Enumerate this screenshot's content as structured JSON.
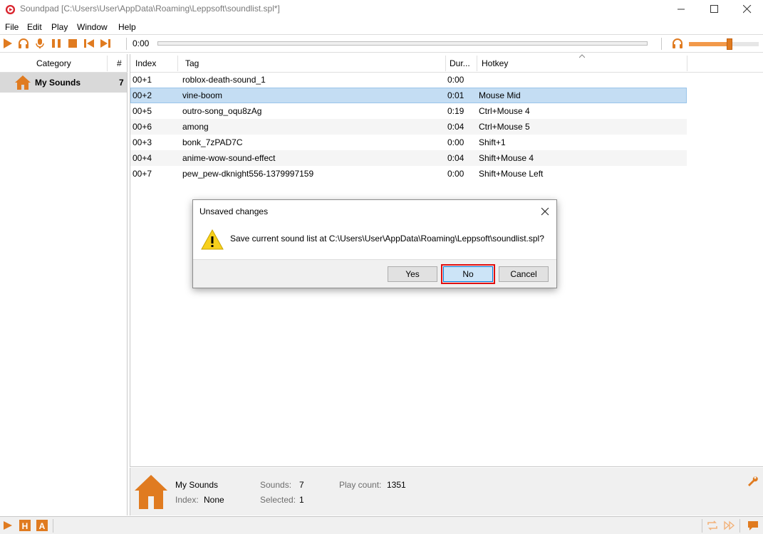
{
  "window": {
    "title": "Soundpad [C:\\Users\\User\\AppData\\Roaming\\Leppsoft\\soundlist.spl*]",
    "accent": "#e07b20"
  },
  "menu": [
    "File",
    "Edit",
    "Play",
    "Window",
    "Help"
  ],
  "toolbar": {
    "time": "0:00",
    "volume_fraction": 0.58,
    "icons": [
      "play-icon",
      "headphones-icon",
      "microphone-icon",
      "pause-icon",
      "stop-icon",
      "previous-icon",
      "next-icon",
      "headphones-icon"
    ]
  },
  "categories": {
    "header_category": "Category",
    "header_count": "#",
    "items": [
      {
        "name": "My Sounds",
        "count": "7"
      }
    ]
  },
  "table": {
    "columns": [
      "Index",
      "Tag",
      "Dur...",
      "Hotkey"
    ],
    "rows": [
      {
        "index": "00+1",
        "tag": "roblox-death-sound_1",
        "duration": "0:00",
        "hotkey": "",
        "selected": false
      },
      {
        "index": "00+2",
        "tag": "vine-boom",
        "duration": "0:01",
        "hotkey": "Mouse Mid",
        "selected": true
      },
      {
        "index": "00+5",
        "tag": "outro-song_oqu8zAg",
        "duration": "0:19",
        "hotkey": "Ctrl+Mouse 4",
        "selected": false
      },
      {
        "index": "00+6",
        "tag": "among",
        "duration": "0:04",
        "hotkey": "Ctrl+Mouse 5",
        "selected": false
      },
      {
        "index": "00+3",
        "tag": "bonk_7zPAD7C",
        "duration": "0:00",
        "hotkey": "Shift+1",
        "selected": false
      },
      {
        "index": "00+4",
        "tag": "anime-wow-sound-effect",
        "duration": "0:04",
        "hotkey": "Shift+Mouse 4",
        "selected": false
      },
      {
        "index": "00+7",
        "tag": "pew_pew-dknight556-1379997159",
        "duration": "0:00",
        "hotkey": "Shift+Mouse Left",
        "selected": false
      }
    ]
  },
  "info": {
    "name": "My Sounds",
    "index_label": "Index:",
    "index_value": "None",
    "sounds_label": "Sounds:",
    "sounds_value": "7",
    "selected_label": "Selected:",
    "selected_value": "1",
    "playcount_label": "Play count:",
    "playcount_value": "1351"
  },
  "bottombar": {
    "icons": [
      "play-icon",
      "hotkey-h-icon",
      "hotkey-a-icon",
      "repeat-icon",
      "forward-icon",
      "chat-icon"
    ]
  },
  "dialog": {
    "title": "Unsaved changes",
    "message": "Save current sound list at C:\\Users\\User\\AppData\\Roaming\\Leppsoft\\soundlist.spl?",
    "yes": "Yes",
    "no": "No",
    "cancel": "Cancel"
  }
}
